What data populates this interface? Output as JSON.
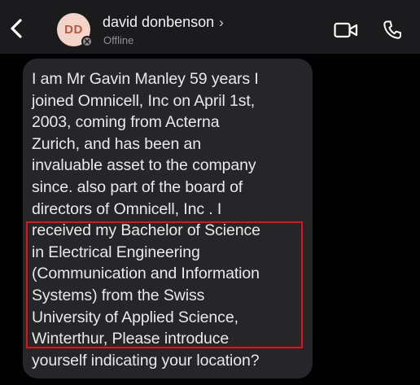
{
  "header": {
    "avatar_initials": "DD",
    "contact_name": "david donbenson",
    "name_chevron": "›",
    "status": "Offline",
    "icons": {
      "back": "chevron-left-icon",
      "video": "video-camera-icon",
      "call": "phone-icon",
      "status": "offline-status-icon"
    }
  },
  "message": {
    "text": "I am Mr Gavin Manley  59 years I\njoined Omnicell, Inc  on April 1st,\n2003, coming from Acterna\nZurich, and has been an\ninvaluable asset to the company\nsince. also part of the board of\ndirectors of  Omnicell, Inc . I\nreceived my Bachelor of Science\nin Electrical Engineering\n(Communication and Information\nSystems) from the Swiss\nUniversity of Applied Science,\nWinterthur, Please introduce\nyourself indicating your location?",
    "highlight_color": "#e0121b"
  },
  "colors": {
    "background": "#000000",
    "header_bg": "#1b1b1d",
    "bubble_bg": "#262628",
    "avatar_bg": "#f3d4c8",
    "avatar_text": "#b45a43"
  }
}
